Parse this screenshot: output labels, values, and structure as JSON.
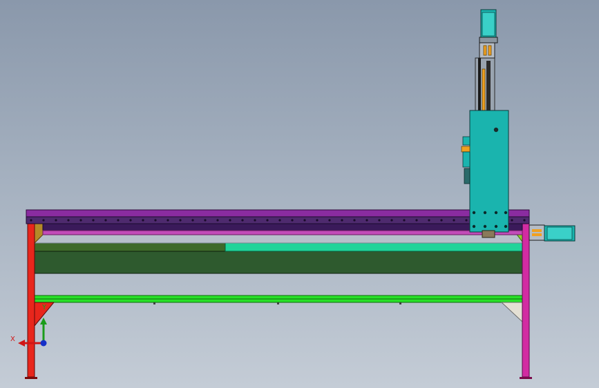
{
  "view": {
    "background_top": "#8a98ab",
    "background_bottom": "#c4ccd6"
  },
  "model": {
    "name": "cnc-gantry-machine",
    "colors": {
      "frame_leg_left": "#e8261c",
      "frame_leg_right": "#d22ca2",
      "gantry_beam": "#8a2ca0",
      "rail_strip": "#4e2a6e",
      "carriage": "#1ab4ae",
      "table_bed": "#2e5a2e",
      "bed_rail": "#20d49a",
      "support_bar": "#28e028",
      "motor": "#1ab4ae",
      "spindle_drive": "#f0a020",
      "gusset_light": "#e4e0d4",
      "gusset_gold": "#b48a28"
    }
  },
  "triad": {
    "x_label": "X",
    "y_label": "Y",
    "x_color": "#d11616",
    "y_color": "#1a9c1a",
    "z_color": "#1530c8"
  }
}
